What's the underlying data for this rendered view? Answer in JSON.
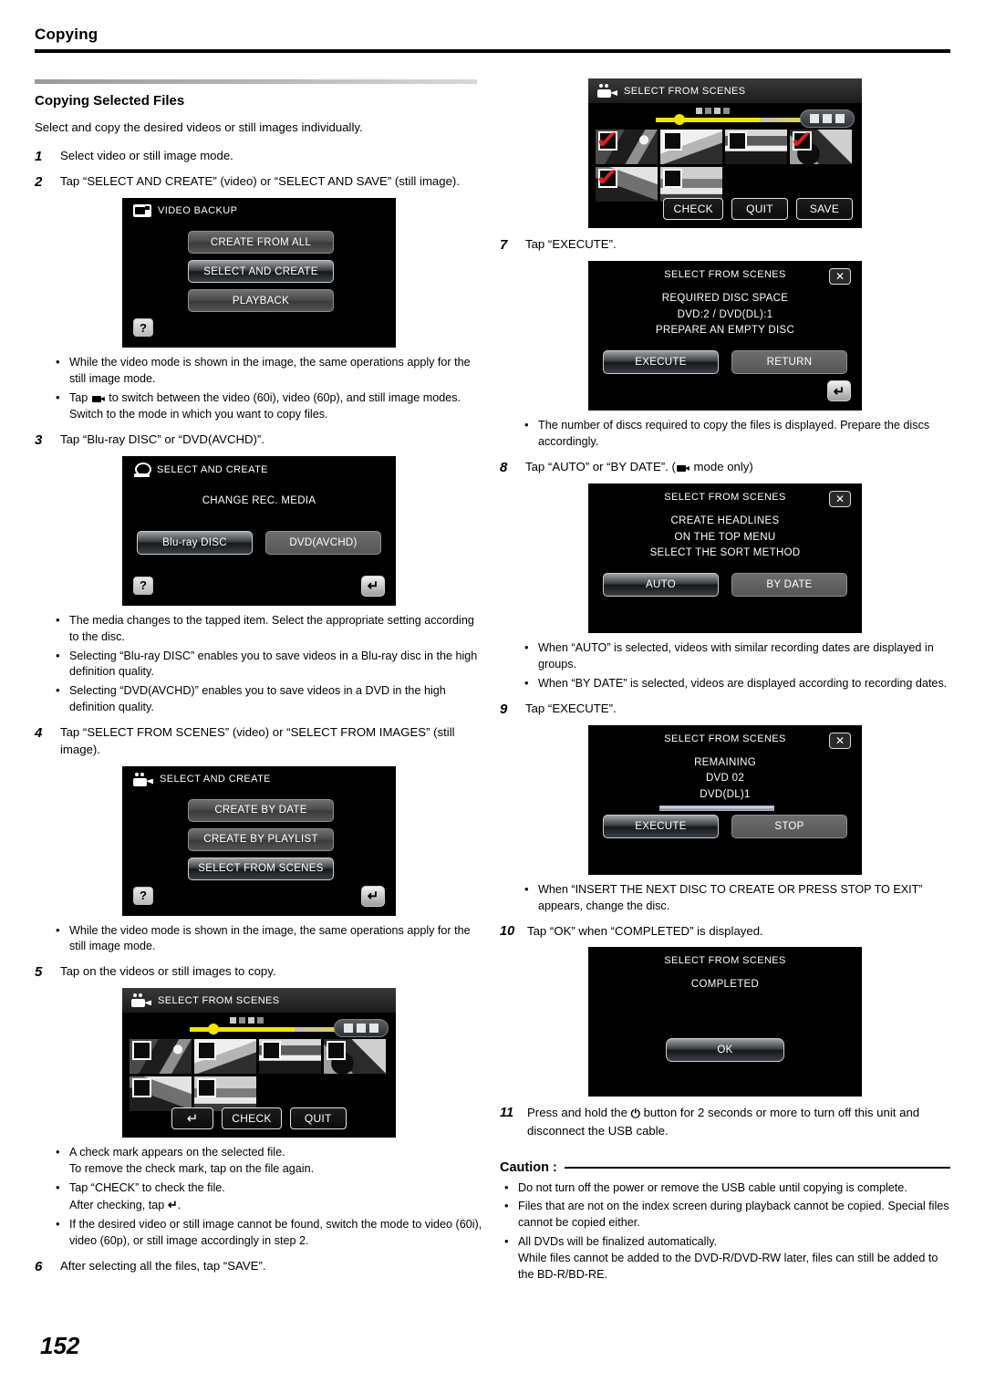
{
  "header": {
    "chapter": "Copying"
  },
  "page_number": "152",
  "left": {
    "section_title": "Copying Selected Files",
    "intro": "Select and copy the desired videos or still images individually.",
    "step1": {
      "num": "1",
      "text": "Select video or still image mode."
    },
    "step2": {
      "num": "2",
      "text": "Tap “SELECT AND CREATE” (video) or “SELECT AND SAVE” (still image)."
    },
    "screen_video_backup": {
      "title": "VIDEO BACKUP",
      "icon": "camcorder-icon",
      "buttons": [
        "CREATE FROM ALL",
        "SELECT AND CREATE",
        "PLAYBACK"
      ],
      "selected_index": 1,
      "help_label": "?"
    },
    "bullets_after_2": [
      "While the video mode is shown in the image, the same operations apply for the still image mode.",
      "Tap � to switch between the video (60i), video (60p), and still image modes. Switch to the mode in which you want to copy files."
    ],
    "step3": {
      "num": "3",
      "text": "Tap “Blu-ray DISC” or “DVD(AVCHD)”."
    },
    "screen_change_media": {
      "title": "SELECT AND CREATE",
      "icon": "disc-drive-icon",
      "body": "CHANGE REC. MEDIA",
      "buttons": [
        "Blu-ray DISC",
        "DVD(AVCHD)"
      ],
      "selected_index": 0,
      "help_label": "?",
      "back_label": "↶"
    },
    "bullets_after_3": [
      "The media changes to the tapped item. Select the appropriate setting according to the disc.",
      "Selecting “Blu-ray DISC” enables you to save videos in a Blu-ray disc in the high definition quality.",
      "Selecting “DVD(AVCHD)” enables you to save videos in a DVD in the high definition quality."
    ],
    "step4": {
      "num": "4",
      "text": "Tap “SELECT FROM SCENES” (video) or “SELECT FROM IMAGES” (still image)."
    },
    "screen_select_create": {
      "title": "SELECT AND CREATE",
      "icon": "camcorder-icon",
      "buttons": [
        "CREATE BY DATE",
        "CREATE BY PLAYLIST",
        "SELECT FROM SCENES"
      ],
      "selected_index": 2,
      "help_label": "?",
      "back_label": "↶"
    },
    "bullets_after_4": [
      "While the video mode is shown in the image, the same operations apply for the still image mode."
    ],
    "step5": {
      "num": "5",
      "text": "Tap on the videos or still images to copy."
    },
    "screen_scenes_unchecked": {
      "title": "SELECT FROM SCENES",
      "icon": "camcorder-icon",
      "checked": [
        false,
        false,
        false,
        false,
        false,
        false
      ],
      "buttons": [
        "↶",
        "CHECK",
        "QUIT"
      ]
    },
    "bullets_after_5": [
      "A check mark appears on the selected file.\nTo remove the check mark, tap on the file again.",
      "Tap “CHECK” to check the file.\nAfter checking, tap �.",
      "If the desired video or still image cannot be found, switch the mode to video (60i), video (60p), or still image accordingly in step 2."
    ],
    "step6": {
      "num": "6",
      "text": "After selecting all the files, tap “SAVE”."
    }
  },
  "right": {
    "screen_scenes_checked": {
      "title": "SELECT FROM SCENES",
      "icon": "camcorder-icon",
      "checked": [
        true,
        false,
        false,
        true,
        true,
        false
      ],
      "buttons": [
        "CHECK",
        "QUIT",
        "SAVE"
      ]
    },
    "step7": {
      "num": "7",
      "text": "Tap “EXECUTE”."
    },
    "screen_disc_space": {
      "title": "SELECT FROM SCENES",
      "body_lines": [
        "REQUIRED DISC SPACE",
        "DVD:2 / DVD(DL):1",
        "PREPARE AN EMPTY DISC"
      ],
      "buttons": [
        "EXECUTE",
        "RETURN"
      ],
      "selected_index": 0,
      "close_label": "✕",
      "back_label": "↶"
    },
    "bullets_after_7": [
      "The number of discs required to copy the files is displayed. Prepare the discs accordingly."
    ],
    "step8": {
      "num": "8",
      "text": "Tap “AUTO” or “BY DATE”. (� mode only)"
    },
    "screen_sort_method": {
      "title": "SELECT FROM SCENES",
      "body_lines": [
        "CREATE HEADLINES",
        "ON THE TOP MENU",
        "SELECT THE SORT METHOD"
      ],
      "buttons": [
        "AUTO",
        "BY DATE"
      ],
      "selected_index": 0,
      "close_label": "✕"
    },
    "bullets_after_8": [
      "When “AUTO” is selected, videos with similar recording dates are displayed in groups.",
      "When “BY DATE” is selected, videos are displayed according to recording dates."
    ],
    "step9": {
      "num": "9",
      "text": "Tap “EXECUTE”."
    },
    "screen_remaining": {
      "title": "SELECT FROM SCENES",
      "body_lines": [
        "REMAINING",
        "DVD   02",
        "DVD(DL)1"
      ],
      "buttons": [
        "EXECUTE",
        "STOP"
      ],
      "selected_index": 0,
      "close_label": "✕",
      "progress": 100
    },
    "bullets_after_9": [
      "When “INSERT THE NEXT DISC TO CREATE OR PRESS STOP TO EXIT” appears, change the disc."
    ],
    "step10": {
      "num": "10",
      "text": "Tap “OK” when “COMPLETED” is displayed."
    },
    "screen_completed": {
      "title": "SELECT FROM SCENES",
      "body_lines": [
        "COMPLETED"
      ],
      "ok_label": "OK"
    },
    "step11": {
      "num": "11",
      "text_before": "Press and hold the",
      "text_after": "button for 2 seconds or more to turn off this unit and disconnect the USB cable."
    },
    "caution": {
      "label": "Caution :",
      "items": [
        "Do not turn off the power or remove the USB cable until copying is complete.",
        "Files that are not on the index screen during playback cannot be copied. Special files cannot be copied either.",
        "All DVDs will be finalized automatically.\nWhile files cannot be added to the DVD-R/DVD-RW later, files can still be added to the BD-R/BD-RE."
      ]
    }
  }
}
